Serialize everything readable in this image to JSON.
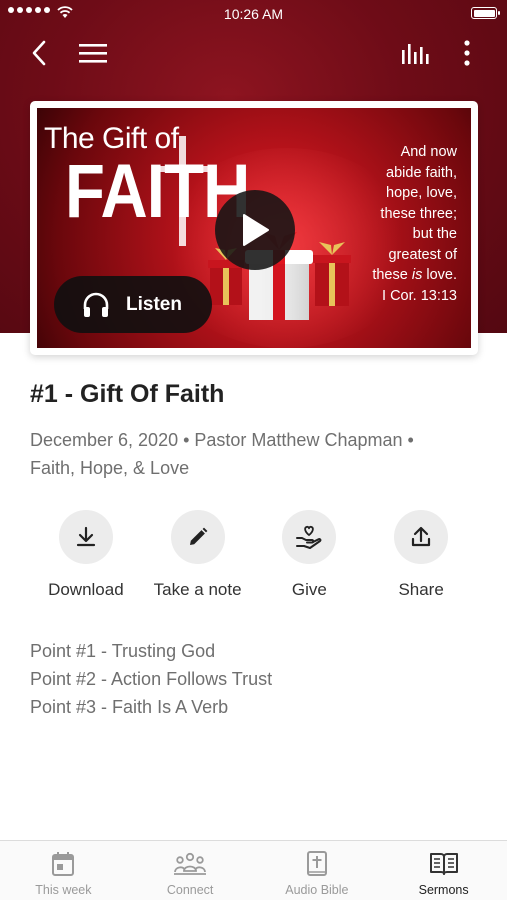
{
  "status_bar": {
    "time": "10:26 AM"
  },
  "sermon": {
    "title": "#1 - Gift Of Faith",
    "meta_line1": "December 6, 2020 • Pastor Matthew Chapman •",
    "meta_line2": "Faith, Hope, & Love",
    "artwork": {
      "title_small": "The Gift of",
      "title_big": "FAITH",
      "verse_lines": [
        "And now",
        "abide faith,",
        "hope, love,",
        "these three;",
        "but the",
        "greatest of",
        "these ",
        "is",
        " love.",
        "I Cor. 13:13"
      ]
    },
    "listen_label": "Listen"
  },
  "actions": [
    {
      "label": "Download",
      "icon": "download-icon"
    },
    {
      "label": "Take a note",
      "icon": "pencil-icon"
    },
    {
      "label": "Give",
      "icon": "give-icon"
    },
    {
      "label": "Share",
      "icon": "share-icon"
    }
  ],
  "points": [
    "Point #1 - Trusting God",
    "Point #2 - Action Follows Trust",
    "Point #3 - Faith Is A Verb"
  ],
  "tabs": [
    {
      "label": "This week",
      "icon": "calendar-icon",
      "active": false
    },
    {
      "label": "Connect",
      "icon": "people-icon",
      "active": false
    },
    {
      "label": "Audio Bible",
      "icon": "bible-icon",
      "active": false
    },
    {
      "label": "Sermons",
      "icon": "open-book-icon",
      "active": true
    }
  ],
  "colors": {
    "hero": "#6e0c17",
    "text_muted": "#6f6f6f",
    "tab_inactive": "#9a9a9a"
  }
}
